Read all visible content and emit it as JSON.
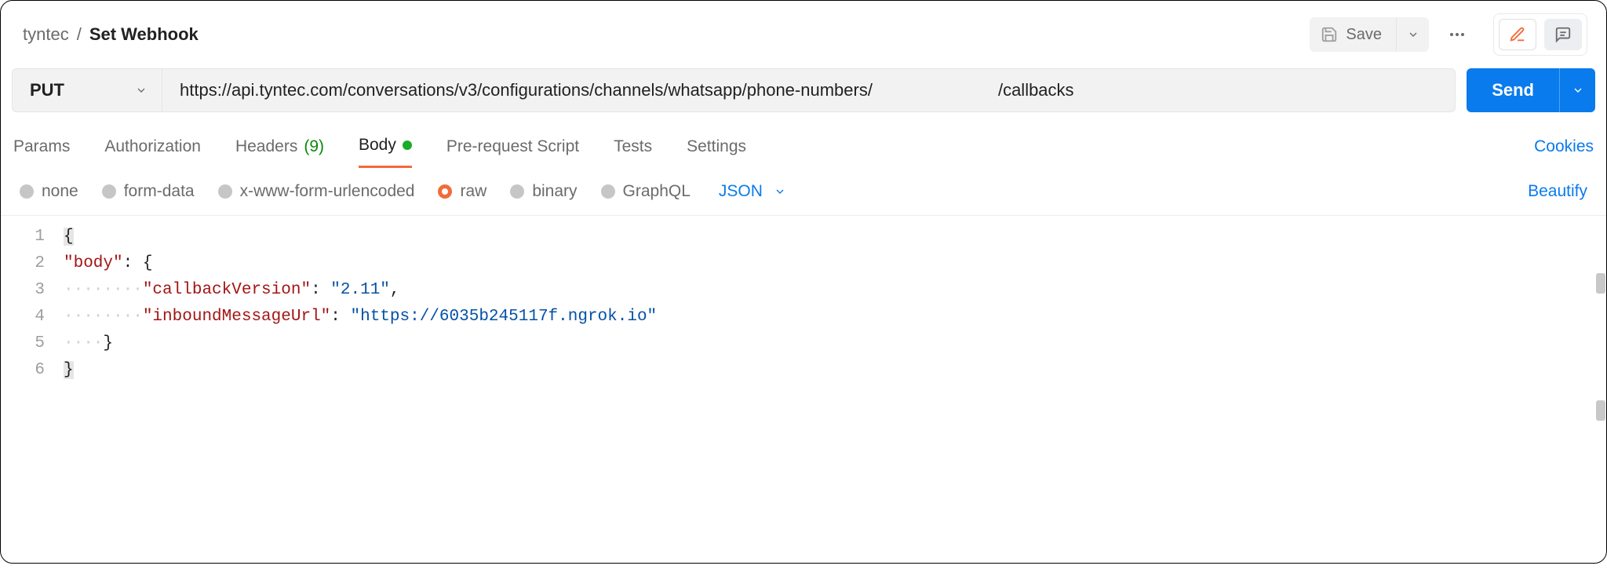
{
  "breadcrumb": {
    "workspace": "tyntec",
    "sep": "/",
    "current": "Set Webhook"
  },
  "topbar": {
    "save": "Save"
  },
  "request": {
    "method": "PUT",
    "url_left": "https://api.tyntec.com/conversations/v3/configurations/channels/whatsapp/phone-numbers/",
    "url_right": "/callbacks",
    "send": "Send"
  },
  "tabs": {
    "params": "Params",
    "auth": "Authorization",
    "headers": "Headers",
    "headers_count": "(9)",
    "body": "Body",
    "prereq": "Pre-request Script",
    "tests": "Tests",
    "settings": "Settings",
    "cookies": "Cookies"
  },
  "body_types": {
    "none": "none",
    "formdata": "form-data",
    "urlencoded": "x-www-form-urlencoded",
    "raw": "raw",
    "binary": "binary",
    "graphql": "GraphQL",
    "format": "JSON",
    "beautify": "Beautify"
  },
  "editor": {
    "lines": [
      "1",
      "2",
      "3",
      "4",
      "5",
      "6"
    ],
    "l1": "{",
    "l2_key": "\"body\"",
    "l2_rest": ": {",
    "l3_key": "\"callbackVersion\"",
    "l3_sep": ": ",
    "l3_val": "\"2.11\"",
    "l3_end": ",",
    "l4_key": "\"inboundMessageUrl\"",
    "l4_sep": ": ",
    "l4_val": "\"https://6035b245117f.ngrok.io\"",
    "l5": "}",
    "l6": "}"
  }
}
